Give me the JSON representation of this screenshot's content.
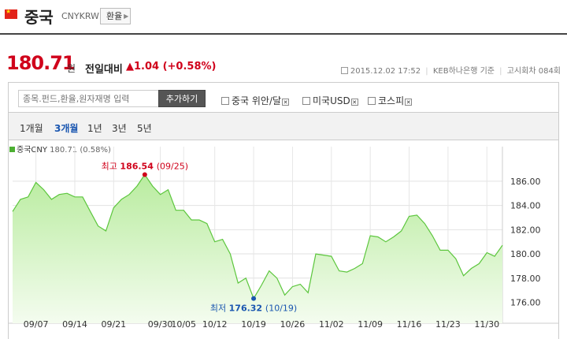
{
  "header": {
    "country": "중국",
    "code": "CNYKRW",
    "exchange_button": "환율",
    "flag_color": "#e2231a"
  },
  "quote": {
    "price": "180.71",
    "unit": "원",
    "change_label": "전일대비",
    "change": "▲1.04 (+0.58%)",
    "timestamp": "2015.12.02 17:52",
    "source": "KEB하나은행 기준",
    "round": "고시회차 084회"
  },
  "compare": {
    "placeholder": "종목.펀드,환율,원자재명 입력",
    "add_button": "추가하기",
    "items": [
      "중국 위안/달",
      "미국USD",
      "코스피"
    ]
  },
  "periods": [
    "1개월",
    "3개월",
    "1년",
    "3년",
    "5년"
  ],
  "active_period": "3개월",
  "chart_data": {
    "type": "area",
    "legend": {
      "name": "중국CNY",
      "detail": "180.71 (0.58%)"
    },
    "color": "#5cc63d",
    "fill_top": "#c8f0b8",
    "x_tick_labels": [
      "09/07",
      "09/14",
      "09/21",
      "09/30",
      "10/05",
      "10/12",
      "10/19",
      "10/26",
      "11/02",
      "11/09",
      "11/16",
      "11/23",
      "11/30"
    ],
    "y_ticks": [
      176.0,
      178.0,
      180.0,
      182.0,
      184.0,
      186.0
    ],
    "y_tick_labels": [
      "176.00",
      "178.00",
      "180.00",
      "182.00",
      "184.00",
      "186.00"
    ],
    "ylim": [
      174.8,
      188.2
    ],
    "dates": [
      "09/02",
      "09/03",
      "09/04",
      "09/07",
      "09/08",
      "09/09",
      "09/10",
      "09/11",
      "09/14",
      "09/15",
      "09/16",
      "09/17",
      "09/18",
      "09/21",
      "09/22",
      "09/23",
      "09/24",
      "09/25",
      "09/29",
      "09/30",
      "10/01",
      "10/02",
      "10/05",
      "10/06",
      "10/07",
      "10/08",
      "10/12",
      "10/13",
      "10/14",
      "10/15",
      "10/16",
      "10/19",
      "10/20",
      "10/21",
      "10/22",
      "10/23",
      "10/26",
      "10/27",
      "10/28",
      "10/29",
      "10/30",
      "11/02",
      "11/03",
      "11/04",
      "11/05",
      "11/06",
      "11/09",
      "11/10",
      "11/11",
      "11/12",
      "11/13",
      "11/16",
      "11/17",
      "11/18",
      "11/19",
      "11/20",
      "11/23",
      "11/24",
      "11/25",
      "11/26",
      "11/27",
      "11/30",
      "12/01",
      "12/02"
    ],
    "values": [
      183.5,
      184.5,
      184.7,
      185.9,
      185.3,
      184.5,
      184.9,
      185.0,
      184.7,
      184.7,
      183.5,
      182.3,
      181.9,
      183.8,
      184.5,
      184.9,
      185.6,
      186.54,
      185.6,
      184.9,
      185.3,
      183.6,
      183.6,
      182.8,
      182.8,
      182.5,
      181.0,
      181.2,
      180.0,
      177.6,
      178.0,
      176.32,
      177.4,
      178.6,
      178.0,
      176.6,
      177.3,
      177.5,
      176.8,
      180.0,
      179.9,
      179.8,
      178.6,
      178.5,
      178.8,
      179.2,
      181.5,
      181.4,
      181.0,
      181.4,
      181.9,
      183.1,
      183.2,
      182.5,
      181.5,
      180.3,
      180.3,
      179.6,
      178.2,
      178.8,
      179.2,
      180.1,
      179.8,
      180.71
    ],
    "max": {
      "label": "최고",
      "value": "186.54",
      "date": "(09/25)"
    },
    "min": {
      "label": "최저",
      "value": "176.32",
      "date": "(10/19)"
    }
  }
}
